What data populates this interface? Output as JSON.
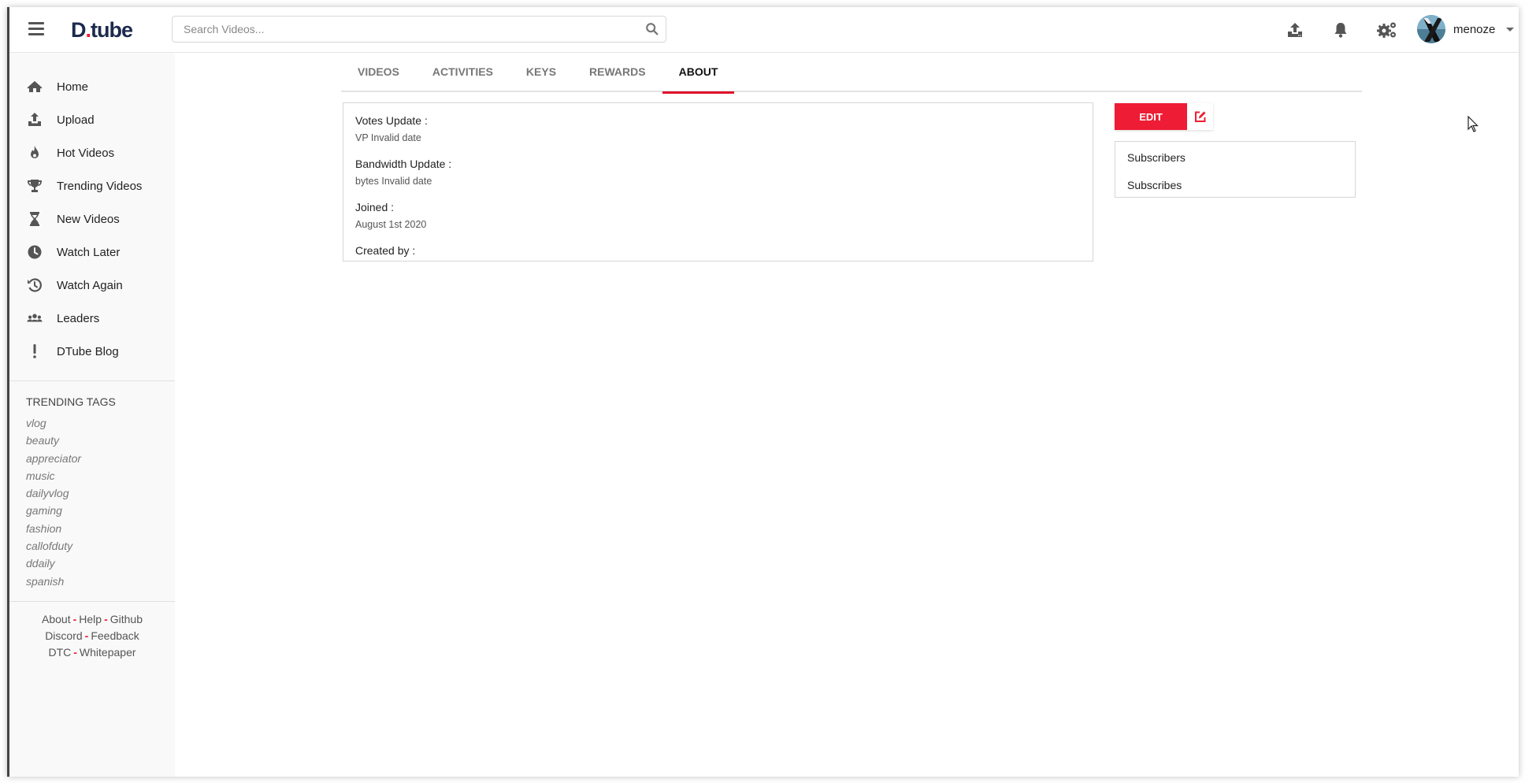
{
  "header": {
    "logo_main": "D",
    "logo_dot": ".",
    "logo_rest": "tube",
    "search_placeholder": "Search Videos...",
    "search_value": "",
    "icons": [
      "menu-icon",
      "upload-icon",
      "bell-icon",
      "settings-gears-icon",
      "search-icon"
    ],
    "username": "menoze"
  },
  "sidebar": {
    "items": [
      {
        "label": "Home",
        "icon": "home-icon"
      },
      {
        "label": "Upload",
        "icon": "upload-icon"
      },
      {
        "label": "Hot Videos",
        "icon": "fire-icon"
      },
      {
        "label": "Trending Videos",
        "icon": "trophy-icon"
      },
      {
        "label": "New Videos",
        "icon": "hourglass-icon"
      },
      {
        "label": "Watch Later",
        "icon": "clock-icon"
      },
      {
        "label": "Watch Again",
        "icon": "history-icon"
      },
      {
        "label": "Leaders",
        "icon": "users-icon"
      },
      {
        "label": "DTube Blog",
        "icon": "exclamation-icon"
      }
    ],
    "trending_title": "TRENDING TAGS",
    "tags": [
      "vlog",
      "beauty",
      "appreciator",
      "music",
      "dailyvlog",
      "gaming",
      "fashion",
      "callofduty",
      "ddaily",
      "spanish"
    ],
    "footer": {
      "row1": [
        "About",
        "Help",
        "Github"
      ],
      "row2": [
        "Discord",
        "Feedback"
      ],
      "row3": [
        "DTC",
        "Whitepaper"
      ],
      "separator": "-"
    }
  },
  "main": {
    "tabs": [
      {
        "label": "VIDEOS",
        "active": false
      },
      {
        "label": "ACTIVITIES",
        "active": false
      },
      {
        "label": "KEYS",
        "active": false
      },
      {
        "label": "REWARDS",
        "active": false
      },
      {
        "label": "ABOUT",
        "active": true
      }
    ],
    "about": {
      "fields": [
        {
          "label": "Votes Update :",
          "value": "VP Invalid date"
        },
        {
          "label": "Bandwidth Update :",
          "value": "bytes Invalid date"
        },
        {
          "label": "Joined :",
          "value": "August 1st 2020"
        },
        {
          "label": "Created by :",
          "value": ""
        }
      ]
    },
    "edit_label": "EDIT",
    "subs": [
      "Subscribers",
      "Subscribes"
    ]
  },
  "colors": {
    "accent": "#ee1c34",
    "logo": "#1c2a4d",
    "icon": "#555555"
  }
}
